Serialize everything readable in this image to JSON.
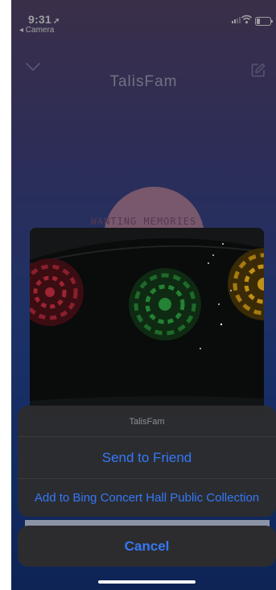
{
  "status_bar": {
    "time": "9:31",
    "back_app": "◂ Camera"
  },
  "app": {
    "title": "TalisFam",
    "icons": [
      "chevron-down-icon",
      "edit-icon"
    ]
  },
  "album": {
    "art_text": "WANTING MEMORIES"
  },
  "action_sheet": {
    "title": "TalisFam",
    "send_to_friend": "Send to Friend",
    "add_to_collection": "Add to Bing Concert Hall Public Collection",
    "cancel": "Cancel"
  },
  "colors": {
    "accent": "#3478f6",
    "sheet_bg": "#2c2c2e",
    "title_muted": "#8e8e93"
  }
}
